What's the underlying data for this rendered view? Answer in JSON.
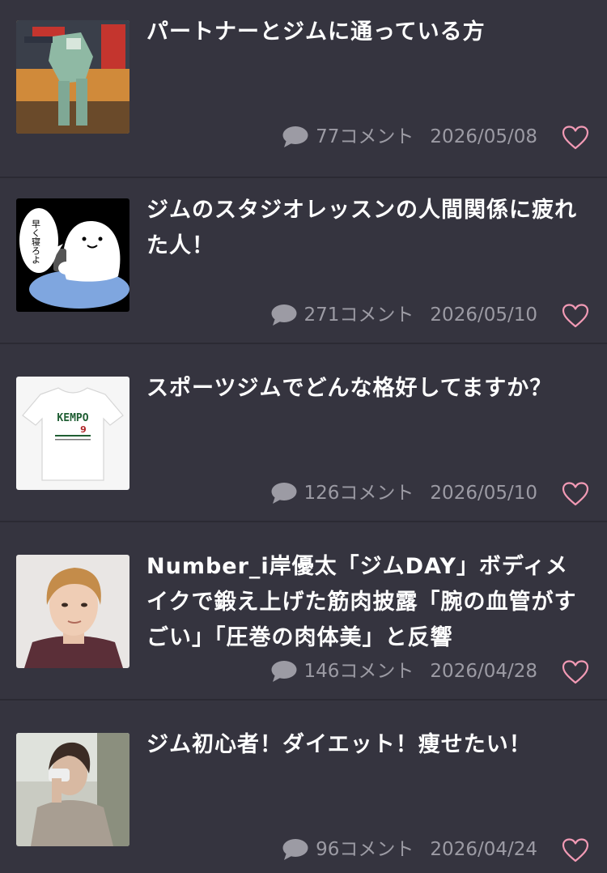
{
  "posts": [
    {
      "title": "パートナーとジムに通っている方",
      "comments": "77コメント",
      "date": "2026/05/08",
      "thumbnail": "mecha-robot-image"
    },
    {
      "title": "ジムのスタジオレッスンの人間関係に疲れた人！",
      "comments": "271コメント",
      "date": "2026/05/10",
      "thumbnail": "cartoon-ghost-image",
      "thumb_text": "早く寝ろよ"
    },
    {
      "title": "スポーツジムでどんな格好してますか？",
      "comments": "126コメント",
      "date": "2026/05/10",
      "thumbnail": "tshirt-image",
      "thumb_text": "KEMPO",
      "thumb_number": "9"
    },
    {
      "title": "Number_i岸優太「ジムDAY」ボディメイクで鍛え上げた筋肉披露「腕の血管がすごい」「圧巻の肉体美」と反響",
      "comments": "146コメント",
      "date": "2026/04/28",
      "thumbnail": "person-portrait-image"
    },
    {
      "title": "ジム初心者！ダイエット！痩せたい！",
      "comments": "96コメント",
      "date": "2026/04/24",
      "thumbnail": "woman-photo-image"
    }
  ],
  "colors": {
    "background": "#35343f",
    "divider": "#2b2a33",
    "title": "#ffffff",
    "meta": "#9c9ba4",
    "heart": "#f29ab5"
  },
  "icons": {
    "comment": "speech-bubble-icon",
    "like": "heart-outline-icon"
  }
}
